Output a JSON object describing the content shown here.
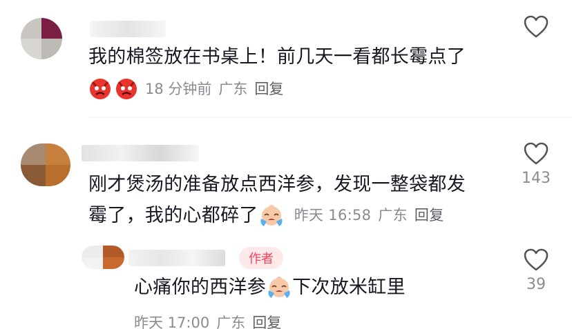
{
  "comments": [
    {
      "text": "我的棉签放在书桌上！前几天一看都长霉点了",
      "time": "18 分钟前",
      "location": "广东",
      "reply_label": "回复",
      "likes": "",
      "emojis": [
        "angry-face-emoji",
        "angry-face-emoji"
      ]
    },
    {
      "text_line1": "刚才煲汤的准备放点西洋参，发现一整袋都发",
      "text_line2": "霉了，我的心都碎了",
      "time": "昨天 16:58",
      "location": "广东",
      "reply_label": "回复",
      "likes": "143",
      "emojis": [
        "crying-face-emoji"
      ]
    },
    {
      "badge": "作者",
      "text_before": "心痛你的西洋参",
      "text_after": "下次放米缸里",
      "time": "昨天 17:00",
      "location": "广东",
      "reply_label": "回复",
      "likes": "39",
      "emojis": [
        "crying-face-emoji"
      ]
    }
  ],
  "colors": {
    "text": "#161823",
    "meta": "#8a8b91",
    "badge_bg": "#fde8ea",
    "badge_text": "#f2425c"
  }
}
